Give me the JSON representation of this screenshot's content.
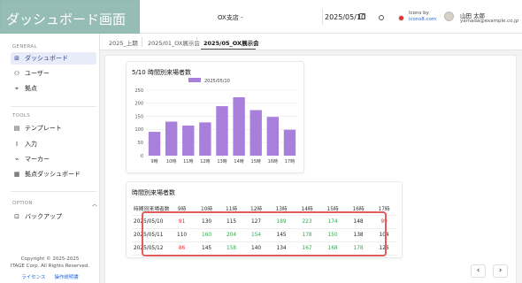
{
  "overlay_title": "ダッシュボード画面",
  "header": {
    "store_select": "OX支店 -",
    "date": "2025/05/10",
    "credit_line1": "Icons by",
    "credit_line2": "icons8.com",
    "user_name": "山田 太郎",
    "user_email": "yamada@example.co.jp"
  },
  "sidebar": {
    "general_label": "GENERAL",
    "general_items": [
      {
        "label": "ダッシュボード",
        "icon": "grid-icon",
        "glyph": "⊞"
      },
      {
        "label": "ユーザー",
        "icon": "users-icon",
        "glyph": "⚇"
      },
      {
        "label": "拠点",
        "icon": "location-icon",
        "glyph": "⌖"
      }
    ],
    "tools_label": "TOOLS",
    "tools_items": [
      {
        "label": "テンプレート",
        "icon": "template-icon",
        "glyph": "▤"
      },
      {
        "label": "入力",
        "icon": "text-cursor-icon",
        "glyph": "Ⅰ"
      },
      {
        "label": "マーカー",
        "icon": "marker-icon",
        "glyph": "⌁"
      },
      {
        "label": "拠点ダッシュボード",
        "icon": "location-dashboard-icon",
        "glyph": "▦"
      }
    ],
    "option_label": "OPTION",
    "option_items": [
      {
        "label": "バックアップ",
        "icon": "backup-icon",
        "glyph": "⊡"
      }
    ],
    "copyright_line1": "Copyright © 2025-2025",
    "copyright_line2": "ITAGE Corp. All Rights Reserved.",
    "link_license": "ライセンス",
    "link_manual": "操作説明書"
  },
  "tabs": [
    "2025_上期",
    "2025/01_OX展示会",
    "2025/05_OX展示会"
  ],
  "active_tab": 2,
  "chart_card": {
    "title": "5/10 時間別来場者数"
  },
  "chart_data": {
    "type": "bar",
    "title": "5/10 時間別来場者数",
    "legend": "2025/05/10",
    "legend_placement": "top-center",
    "categories": [
      "9時",
      "10時",
      "11時",
      "12時",
      "13時",
      "14時",
      "15時",
      "16時",
      "17時"
    ],
    "values": [
      91,
      130,
      115,
      127,
      189,
      223,
      174,
      148,
      99
    ],
    "ylim": [
      0,
      250
    ],
    "yticks": [
      0,
      50,
      100,
      150,
      200,
      250
    ],
    "grid": true,
    "color": "#a97fdc"
  },
  "table_card": {
    "title": "時間別来場者数",
    "header_first": "時間別来場者数",
    "columns": [
      "9時",
      "10時",
      "11時",
      "12時",
      "13時",
      "14時",
      "15時",
      "16時",
      "17時"
    ],
    "rows": [
      {
        "date": "2025/05/10",
        "values": [
          "91",
          "130",
          "115",
          "127",
          "189",
          "223",
          "174",
          "148",
          "99"
        ]
      },
      {
        "date": "2025/05/11",
        "values": [
          "110",
          "160",
          "204",
          "154",
          "145",
          "178",
          "150",
          "138",
          "104"
        ]
      },
      {
        "date": "2025/05/12",
        "values": [
          "86",
          "145",
          "158",
          "140",
          "134",
          "167",
          "168",
          "178",
          "126"
        ]
      }
    ],
    "cell_colors": [
      [
        "red",
        "",
        "",
        "",
        "green",
        "green",
        "green",
        "",
        "red"
      ],
      [
        "",
        "green",
        "green",
        "green",
        "",
        "green",
        "green",
        "",
        ""
      ],
      [
        "red",
        "",
        "green",
        "",
        "",
        "green",
        "green",
        "green",
        ""
      ]
    ],
    "color_high": "#2fa84f",
    "color_low": "#e03131"
  },
  "pager": {
    "prev": "‹",
    "next": "›"
  }
}
